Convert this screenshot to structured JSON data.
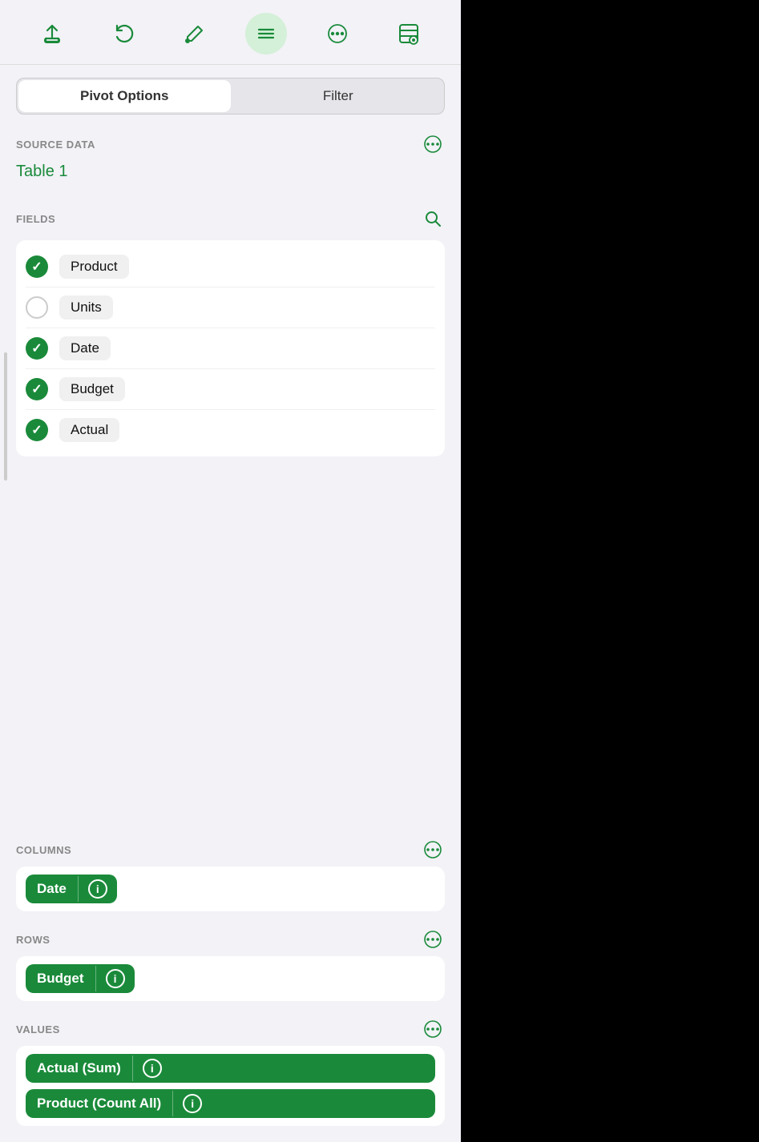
{
  "toolbar": {
    "buttons": [
      {
        "name": "share-button",
        "icon": "⬆",
        "label": "Share",
        "active": false
      },
      {
        "name": "undo-button",
        "icon": "↩",
        "label": "Undo",
        "active": false
      },
      {
        "name": "annotate-button",
        "icon": "✏",
        "label": "Annotate",
        "active": false
      },
      {
        "name": "format-button",
        "icon": "≡",
        "label": "Format",
        "active": true
      },
      {
        "name": "more-button",
        "icon": "•••",
        "label": "More",
        "active": false
      },
      {
        "name": "settings-button",
        "icon": "☰",
        "label": "Settings",
        "active": false
      }
    ]
  },
  "segmented": {
    "options": [
      {
        "id": "pivot-options",
        "label": "Pivot Options",
        "active": true
      },
      {
        "id": "filter",
        "label": "Filter",
        "active": false
      }
    ]
  },
  "source_data": {
    "label": "SOURCE DATA",
    "table_name": "Table 1"
  },
  "fields": {
    "label": "FIELDS",
    "items": [
      {
        "name": "Product",
        "checked": true
      },
      {
        "name": "Units",
        "checked": false
      },
      {
        "name": "Date",
        "checked": true
      },
      {
        "name": "Budget",
        "checked": true
      },
      {
        "name": "Actual",
        "checked": true
      }
    ]
  },
  "columns": {
    "label": "COLUMNS",
    "tag": "Date"
  },
  "rows": {
    "label": "ROWS",
    "tag": "Budget"
  },
  "values": {
    "label": "VALUES",
    "tags": [
      "Actual (Sum)",
      "Product (Count All)"
    ]
  },
  "colors": {
    "green": "#1a8a3a",
    "light_green_bg": "#d4f0d8",
    "gray_bg": "#f2f2f7",
    "white": "#ffffff"
  }
}
